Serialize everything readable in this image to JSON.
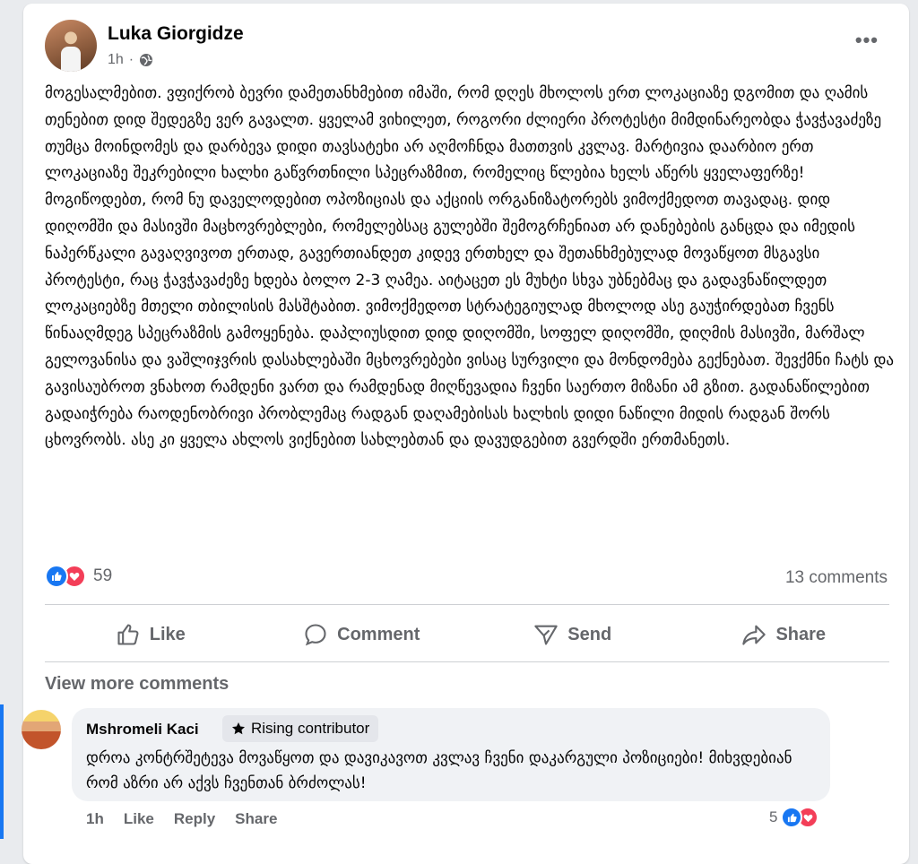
{
  "post": {
    "author": "Luka Giorgidze",
    "time": "1h",
    "separator": "·",
    "audience_icon": "globe-icon",
    "more_icon": "more-options-icon",
    "more_label": "•••",
    "text": "მოგესალმებით. ვფიქრობ ბევრი დამეთანხმებით იმაში, რომ დღეს მხოლოს ერთ ლოკაციაზე დგომით და ღამის თენებით დიდ შედეგზე ვერ გავალთ. ყველამ ვიხილეთ, როგორი ძლიერი პროტესტი მიმდინარეობდა ჭავჭავაძეზე თუმცა მოინდომეს და დარბევა დიდი თავსატეხი არ აღმოჩნდა მათთვის კვლავ. მარტივია დაარბიო ერთ ლოკაციაზე შეკრებილი ხალხი გაწვრთნილი სპეცრაზმით, რომელიც წლებია ხელს აწერს ყველაფერზე! მოგიწოდებთ, რომ ნუ დაველოდებით ოპოზიციას და აქციის ორგანიზატორებს ვიმოქმედოთ თავადაც. დიდ დიღომში და მასივში მაცხოვრებლები, რომელებსაც გულებში შემოგრჩენიათ არ დანებების განცდა და იმედის ნაპერწკალი გავაღვივოთ ერთად, გავერთიანდეთ კიდევ ერთხელ და შეთანხმებულად მოვაწყოთ მსგავსი პროტესტი, რაც ჭავჭავაძეზე ხდება ბოლო 2-3 ღამეა. აიტაცეთ ეს მუხტი სხვა უბნებმაც და გადავნაწილდეთ ლოკაციებზე მთელი თბილისის მასშტაბით. ვიმოქმედოთ სტრატეგიულად მხოლოდ ასე გაუჭირდებათ ჩვენს წინააღმდეგ სპეცრაზმის გამოყენება. დაპლიუსდით დიდ დიღომში, სოფელ დიღომში, დიღმის მასივში, მარშალ გელოვანისა და ვაშლიჯვრის დასახლებაში მცხოვრებები ვისაც სურვილი და მონდომება გექნებათ. შევქმნი ჩატს და გავისაუბროთ ვნახოთ რამდენი ვართ და რამდენად მიღწევადია ჩვენი საერთო მიზანი ამ გზით. გადანაწილებით გადაიჭრება რაოდენობრივი პრობლემაც რადგან დაღამებისას ხალხის დიდი ნაწილი მიდის რადგან შორს ცხოვრობს. ასე კი ყველა ახლოს ვიქნებით სახლებთან და დავუდგებით გვერდში ერთმანეთს.",
    "reaction_count": "59",
    "comments_count": "13 comments",
    "actions": [
      {
        "label": "Like",
        "icon": "thumbs-up-icon"
      },
      {
        "label": "Comment",
        "icon": "comment-icon"
      },
      {
        "label": "Send",
        "icon": "send-icon"
      },
      {
        "label": "Share",
        "icon": "share-icon"
      }
    ]
  },
  "comments_section": {
    "view_more": "View more comments",
    "comment": {
      "author": "Mshromeli Kaci",
      "badge": "Rising contributor",
      "badge_icon": "star-icon",
      "text": "დროა კონტრშეტევა მოვაწყოთ და დავიკავოთ კვლავ ჩვენი დაკარგული პოზიციები! მიხვდებიან რომ აზრი არ აქვს ჩვენთან ბრძოლას!",
      "time": "1h",
      "like": "Like",
      "reply": "Reply",
      "share": "Share",
      "reaction_count": "5"
    }
  },
  "colors": {
    "accent": "#1877f2",
    "love": "#f33e58",
    "secondary_text": "#65676b"
  }
}
